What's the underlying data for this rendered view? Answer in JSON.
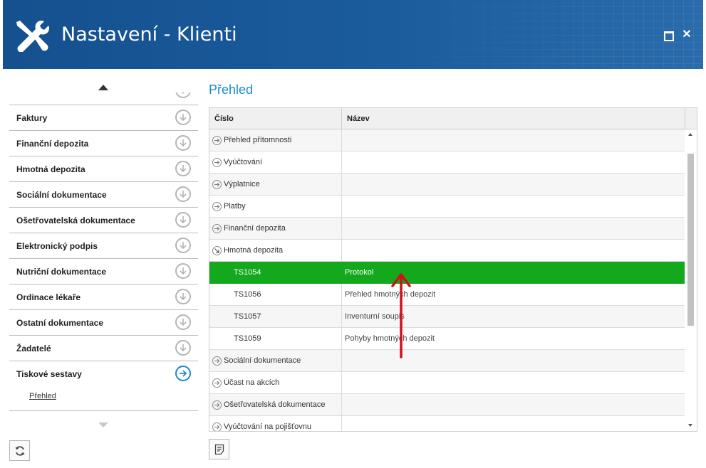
{
  "window": {
    "title": "Nastavení - Klienti",
    "accent_color": "#1b5c9d",
    "icon": "tools-icon"
  },
  "sidebar": {
    "items": [
      {
        "label": "Faktury",
        "icon": "arrow-down-circle-icon"
      },
      {
        "label": "Finanční depozita",
        "icon": "arrow-down-circle-icon"
      },
      {
        "label": "Hmotná depozita",
        "icon": "arrow-down-circle-icon"
      },
      {
        "label": "Sociální dokumentace",
        "icon": "arrow-down-circle-icon"
      },
      {
        "label": "Ošetřovatelská dokumentace",
        "icon": "arrow-down-circle-icon"
      },
      {
        "label": "Elektronický podpis",
        "icon": "arrow-down-circle-icon"
      },
      {
        "label": "Nutriční dokumentace",
        "icon": "arrow-down-circle-icon"
      },
      {
        "label": "Ordinace lékaře",
        "icon": "arrow-down-circle-icon"
      },
      {
        "label": "Ostatní dokumentace",
        "icon": "arrow-down-circle-icon"
      },
      {
        "label": "Žadatelé",
        "icon": "arrow-down-circle-icon"
      },
      {
        "label": "Tiskové sestavy",
        "icon": "arrow-right-circle-icon",
        "active": true
      }
    ],
    "sub_items": [
      {
        "label": "Přehled"
      }
    ]
  },
  "main": {
    "section_title": "Přehled",
    "columns": [
      "Číslo",
      "Název"
    ],
    "rows": [
      {
        "type": "group",
        "number": "Přehled přítomnosti",
        "name": ""
      },
      {
        "type": "group",
        "number": "Vyúčtování",
        "name": ""
      },
      {
        "type": "group",
        "number": "Výplatnice",
        "name": ""
      },
      {
        "type": "group",
        "number": "Platby",
        "name": ""
      },
      {
        "type": "group",
        "number": "Finanční depozita",
        "name": ""
      },
      {
        "type": "group-expanded",
        "number": "Hmotná depozita",
        "name": ""
      },
      {
        "type": "child",
        "number": "TS1054",
        "name": "Protokol",
        "selected": true
      },
      {
        "type": "child",
        "number": "TS1056",
        "name": "Přehled hmotných depozit"
      },
      {
        "type": "child",
        "number": "TS1057",
        "name": "Inventurní soupis"
      },
      {
        "type": "child",
        "number": "TS1059",
        "name": "Pohyby hmotných depozit"
      },
      {
        "type": "group",
        "number": "Sociální dokumentace",
        "name": ""
      },
      {
        "type": "group",
        "number": "Účast na akcích",
        "name": ""
      },
      {
        "type": "group",
        "number": "Ošetřovatelská dokumentace",
        "name": ""
      },
      {
        "type": "group",
        "number": "Vyúčtování na pojišťovnu",
        "name": ""
      }
    ],
    "selected_color": "#14a81d"
  },
  "annotation": {
    "color": "#d0101a"
  }
}
